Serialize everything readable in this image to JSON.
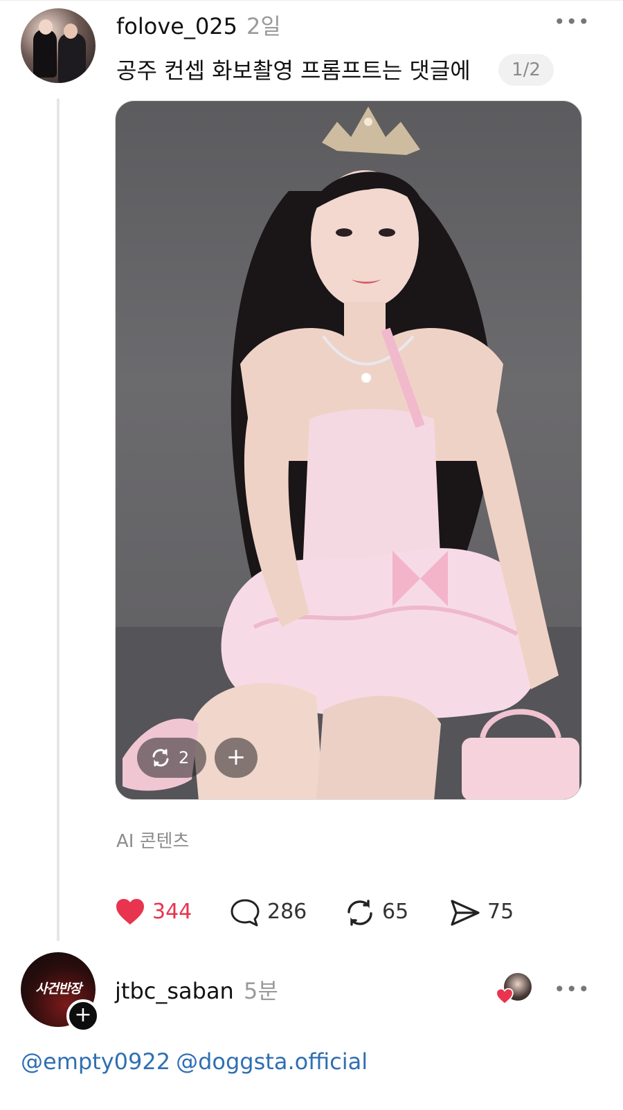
{
  "post1": {
    "username": "folove_025",
    "time": "2일",
    "caption": "공주 컨셉 화보촬영 프롬프트는 댓글에",
    "page_indicator": "1/2",
    "repost_chip_count": "2",
    "add_chip_label": "+",
    "ai_label": "AI 콘텐츠",
    "actions": {
      "likes": "344",
      "comments": "286",
      "reposts": "65",
      "shares": "75"
    },
    "more_label": "•••"
  },
  "post2": {
    "username": "jtbc_saban",
    "time": "5분",
    "avatar_text": "사건반장",
    "follow_label": "+",
    "more_label": "•••",
    "mentions": [
      "@empty0922",
      "@doggsta.official"
    ]
  },
  "colors": {
    "like_red": "#e8344e",
    "mention_blue": "#2f6fb3",
    "muted_gray": "#9a9a9a"
  },
  "icons": [
    "heart-icon",
    "comment-icon",
    "repost-icon",
    "share-icon",
    "more-icon",
    "plus-icon"
  ]
}
